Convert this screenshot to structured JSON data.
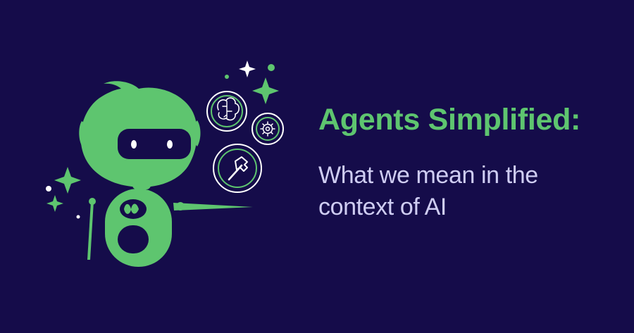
{
  "content": {
    "title": "Agents Simplified:",
    "subtitle": "What we mean in the context of AI"
  },
  "colors": {
    "background": "#150c4a",
    "accent_green": "#5ec56f",
    "text_light": "#cfcdf2",
    "white": "#ffffff"
  },
  "icons": {
    "robot": "robot-mascot-icon",
    "brain": "brain-icon",
    "gear": "gear-icon",
    "hammer": "hammer-icon",
    "sparkle": "sparkle-icon"
  }
}
